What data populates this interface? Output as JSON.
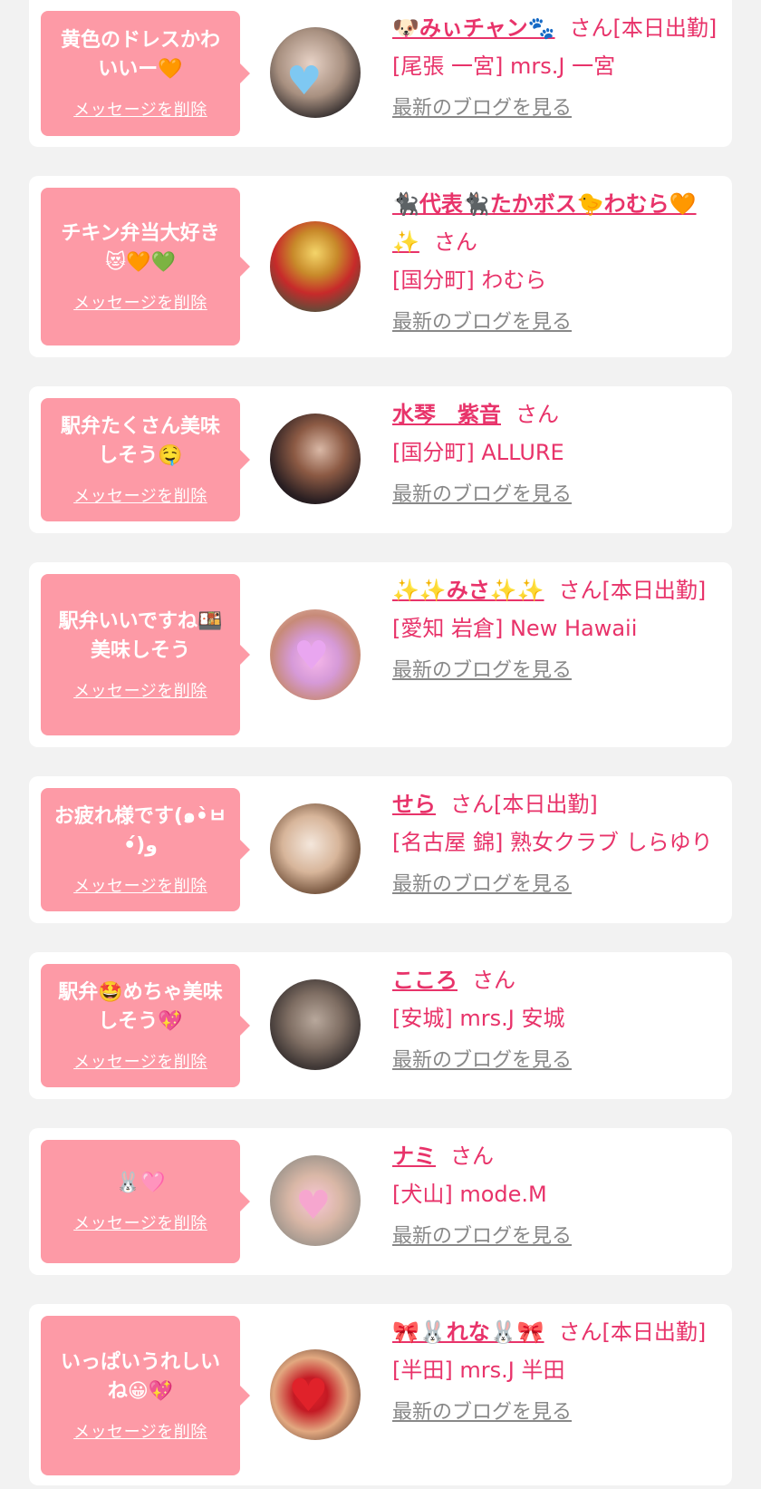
{
  "delete_label": "メッセージを削除",
  "blog_label": "最新のブログを見る",
  "san_label": "さん",
  "colors": {
    "page_bg": "#f2f2f2",
    "card_bg": "#ffffff",
    "bubble_bg": "#fd9aa6",
    "accent": "#e8336a",
    "link_gray": "#888888"
  },
  "messages": [
    {
      "message": "黄色のドレスかわいいー🧡",
      "name": "🐶みぃチャン🐾",
      "status": "[本日出勤]",
      "shop": "[尾張 一宮] mrs.J 一宮"
    },
    {
      "message": "チキン弁当大好き😻🧡💚",
      "name": "🐈‍⬛代表🐈‍⬛たかボス🐤わむら🧡✨",
      "status": "",
      "shop": "[国分町] わむら"
    },
    {
      "message": "駅弁たくさん美味しそう🤤",
      "name": "水琴　紫音",
      "status": "",
      "shop": "[国分町] ALLURE"
    },
    {
      "message": "駅弁いいですね🍱美味しそう",
      "name": "✨✨みさ✨✨",
      "status": "[本日出勤]",
      "shop": "[愛知 岩倉] New Hawaii"
    },
    {
      "message": "お疲れ様です(๑•̀ㅂ•́)و",
      "name": "せら",
      "status": "[本日出勤]",
      "shop": "[名古屋 錦] 熟女クラブ しらゆり"
    },
    {
      "message": "駅弁🤩めちゃ美味しそう💖",
      "name": "こころ",
      "status": "",
      "shop": "[安城] mrs.J 安城"
    },
    {
      "message": "🐰🩷",
      "name": "ナミ",
      "status": "",
      "shop": "[犬山] mode.M"
    },
    {
      "message": "いっぱいうれしいね😀💖",
      "name": "🎀🐰れな🐰🎀",
      "status": "[本日出勤]",
      "shop": "[半田] mrs.J 半田"
    }
  ]
}
